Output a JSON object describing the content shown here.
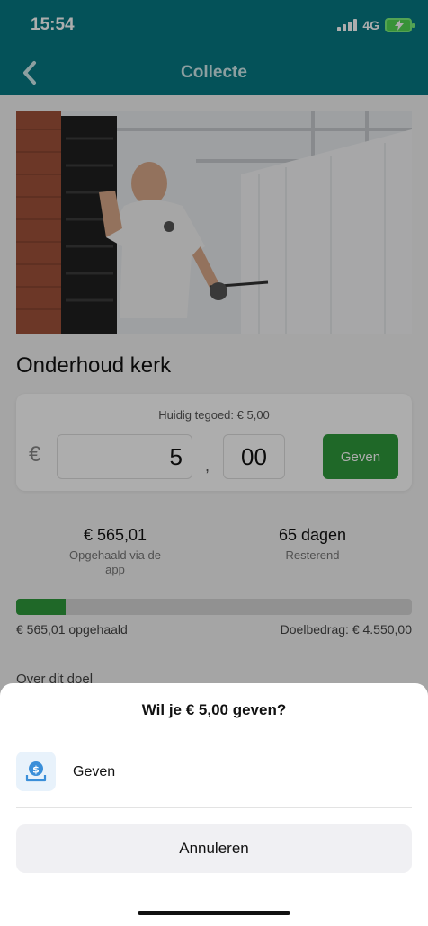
{
  "status": {
    "time": "15:54",
    "network": "4G"
  },
  "nav": {
    "title": "Collecte",
    "back_icon": "chevron-left-icon"
  },
  "page": {
    "title": "Onderhoud kerk"
  },
  "donate": {
    "balance": "Huidig tegoed: € 5,00",
    "currency": "€",
    "amount_int": "5",
    "comma": ",",
    "amount_dec": "00",
    "button": "Geven"
  },
  "stats": [
    {
      "value": "€ 565,01",
      "label": "Opgehaald via de app"
    },
    {
      "value": "65 dagen",
      "label": "Resterend"
    }
  ],
  "progress": {
    "fraction": 0.124,
    "raised": "€ 565,01 opgehaald",
    "goal": "Doelbedrag: € 4.550,00"
  },
  "about": "Over dit doel",
  "sheet": {
    "title": "Wil je € 5,00 geven?",
    "give_label": "Geven",
    "give_icon": "donate-icon",
    "cancel": "Annuleren"
  },
  "colors": {
    "header": "#077a84",
    "accent_green": "#2f9a3c",
    "icon_blue": "#3b8fd9"
  }
}
